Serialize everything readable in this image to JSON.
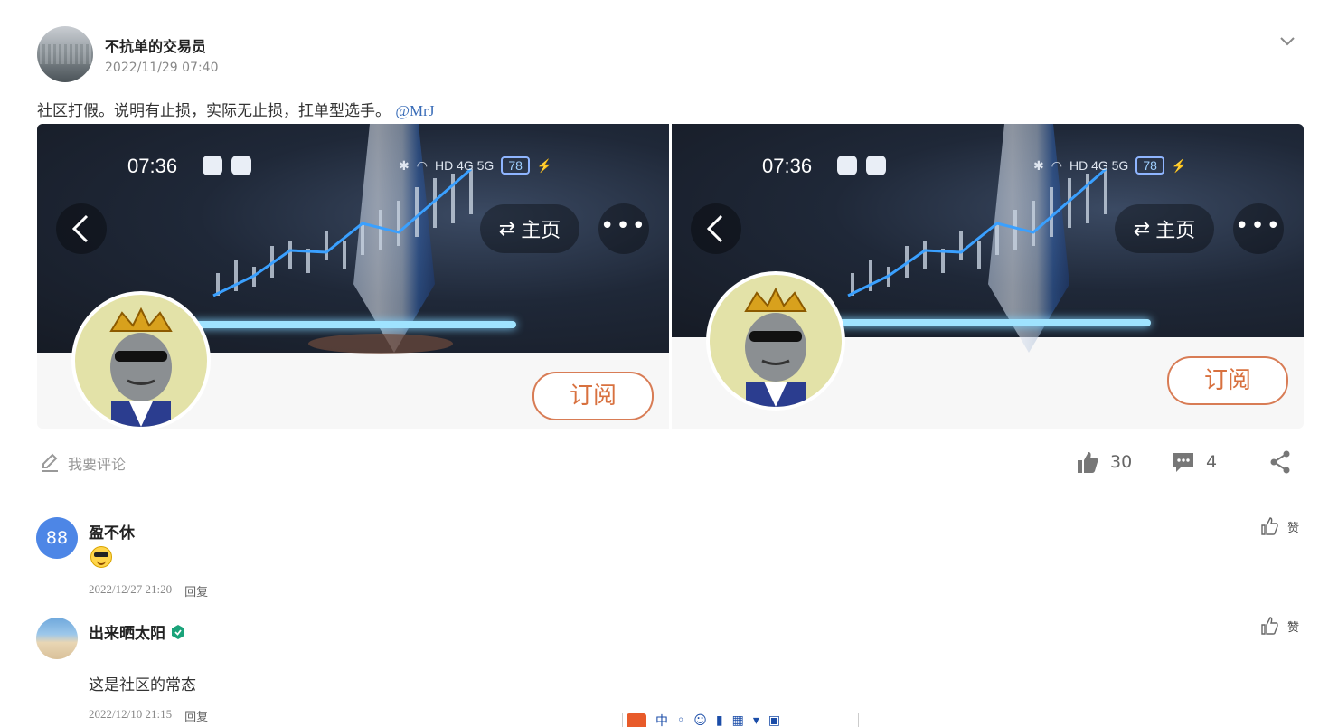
{
  "post": {
    "author": "不抗单的交易员",
    "time": "2022/11/29 07:40",
    "text": "社区打假。说明有止损，实际无止损，扛单型选手。",
    "mention": "@MrJ"
  },
  "screenshots": [
    {
      "clock": "07:36",
      "battery": "78",
      "home_label": "主页",
      "subscribe_label": "订阅",
      "net": "HD 4G 5G"
    },
    {
      "clock": "07:36",
      "battery": "78",
      "home_label": "主页",
      "subscribe_label": "订阅",
      "net": "HD 4G 5G"
    }
  ],
  "actions": {
    "comment_placeholder": "我要评论",
    "likes": "30",
    "comments": "4"
  },
  "comments": [
    {
      "avatar_text": "88",
      "name": "盈不休",
      "text": "",
      "emoji": "sunglasses-face",
      "time": "2022/12/27 21:20",
      "reply": "回复",
      "like": "赞"
    },
    {
      "avatar_text": "",
      "name": "出来晒太阳",
      "text": "这是社区的常态",
      "time": "2022/12/10 21:15",
      "reply": "回复",
      "like": "赞"
    }
  ],
  "ime_toolbar": {
    "label": "中"
  },
  "colors": {
    "accent": "#3a6db8",
    "subscribe": "#d8713f",
    "avatar_blue": "#4d86e6",
    "badge": "#1aa37a"
  }
}
